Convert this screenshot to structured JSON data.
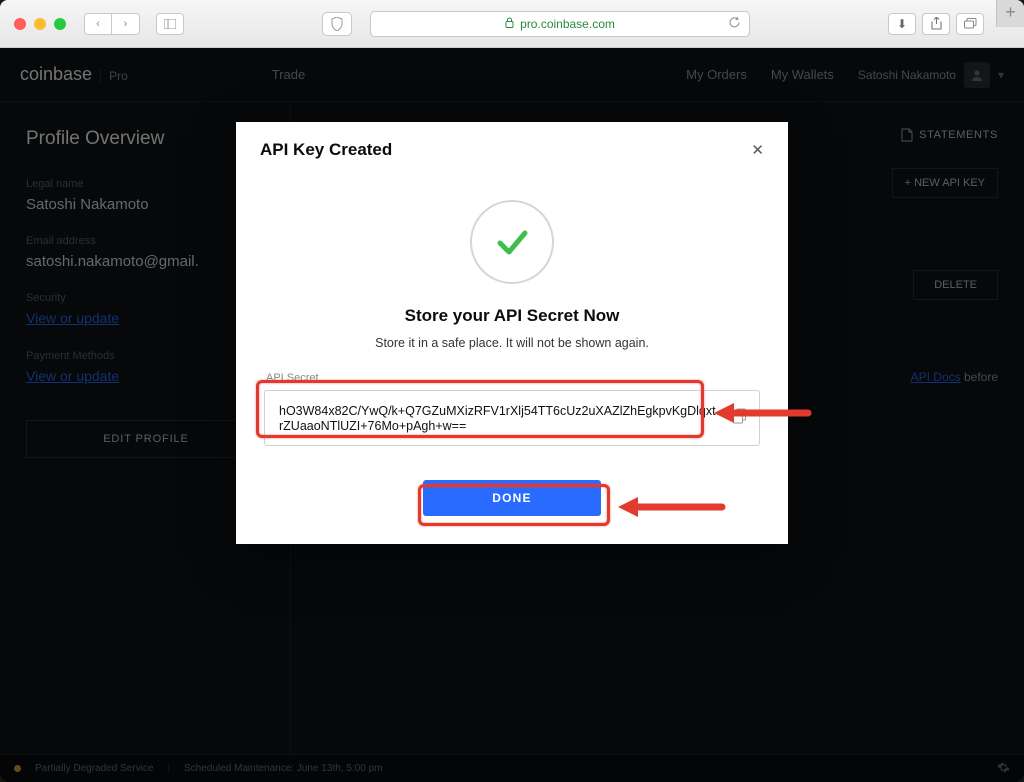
{
  "browser": {
    "url_display": "pro.coinbase.com"
  },
  "header": {
    "brand": "coinbase",
    "brand_sub": "Pro",
    "nav_trade": "Trade",
    "nav_orders": "My Orders",
    "nav_wallets": "My Wallets",
    "user_name": "Satoshi Nakamoto"
  },
  "sidebar": {
    "title": "Profile Overview",
    "legal_name_label": "Legal name",
    "legal_name_value": "Satoshi Nakamoto",
    "email_label": "Email address",
    "email_value": "satoshi.nakamoto@gmail.",
    "security_label": "Security",
    "security_link": "View or update",
    "payment_label": "Payment Methods",
    "payment_link": "View or update",
    "edit_profile": "EDIT PROFILE"
  },
  "main": {
    "tab_statements": "STATEMENTS",
    "new_api_key": "+ NEW API KEY",
    "delete": "DELETE",
    "docs_prefix": " ",
    "docs_link": "API Docs",
    "docs_suffix": " before"
  },
  "status": {
    "status_label": "Partially Degraded Service",
    "maintenance": "Scheduled Maintenance: June 13th, 5:00 pm"
  },
  "modal": {
    "heading": "API Key Created",
    "title": "Store your API Secret Now",
    "subtitle": "Store it in a safe place. It will not be shown again.",
    "secret_label": "API Secret",
    "secret_value": "hO3W84x82C/YwQ/k+Q7GZuMXizRFV1rXlj54TT6cUz2uXAZlZhEgkpvKgDlqxtrZUaaoNTlUZI+76Mo+pAgh+w==",
    "done": "DONE"
  }
}
